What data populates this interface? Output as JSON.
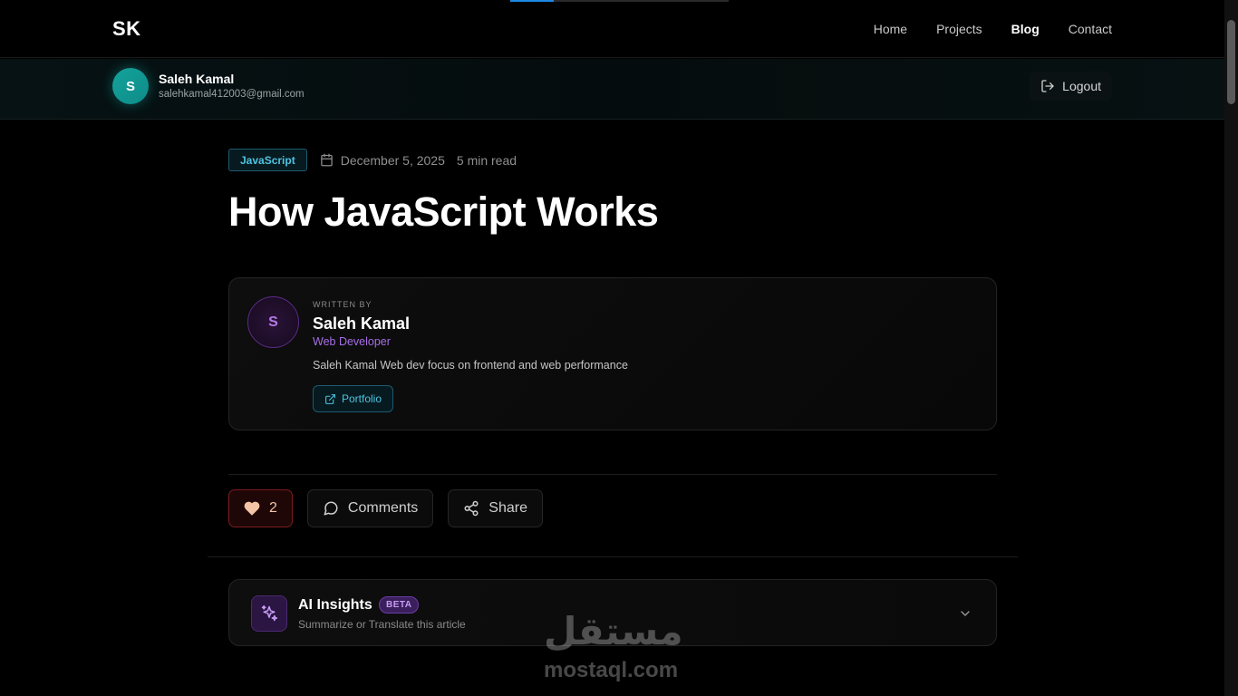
{
  "progress": {
    "fraction": 0.2
  },
  "nav": {
    "logo": "SK",
    "links": [
      {
        "label": "Home",
        "active": false
      },
      {
        "label": "Projects",
        "active": false
      },
      {
        "label": "Blog",
        "active": true
      },
      {
        "label": "Contact",
        "active": false
      }
    ]
  },
  "user": {
    "initial": "S",
    "name": "Saleh Kamal",
    "email": "salehkamal412003@gmail.com",
    "logout_label": "Logout"
  },
  "article": {
    "tag": "JavaScript",
    "date": "December 5, 2025",
    "read_time": "5 min read",
    "title": "How JavaScript Works"
  },
  "author": {
    "written_by": "WRITTEN BY",
    "initial": "S",
    "name": "Saleh Kamal",
    "role": "Web Developer",
    "bio": "Saleh Kamal Web dev focus on frontend and web performance",
    "portfolio_label": "Portfolio"
  },
  "actions": {
    "likes": "2",
    "comments_label": "Comments",
    "share_label": "Share"
  },
  "ai": {
    "title": "AI Insights",
    "badge": "BETA",
    "subtitle": "Summarize or Translate this article"
  },
  "watermark": {
    "arabic": "مستقل",
    "latin": "mostaql.com"
  },
  "colors": {
    "accent_cyan": "#4fc3e0",
    "accent_purple": "#a66ee6",
    "progress_blue": "#1e88e5",
    "like_red": "#7a1c1c"
  }
}
